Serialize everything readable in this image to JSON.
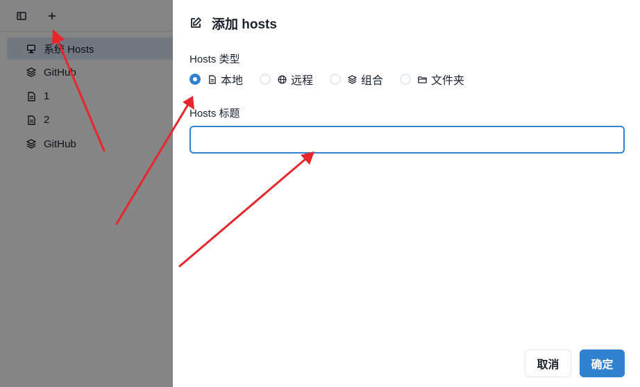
{
  "sidebar": {
    "items": [
      {
        "label": "系统 Hosts",
        "icon": "monitor-icon",
        "selected": true
      },
      {
        "label": "GitHub",
        "icon": "layers-icon",
        "selected": false
      },
      {
        "label": "1",
        "icon": "file-icon",
        "selected": false
      },
      {
        "label": "2",
        "icon": "file-icon",
        "selected": false
      },
      {
        "label": "GitHub",
        "icon": "layers-icon",
        "selected": false
      }
    ]
  },
  "drawer": {
    "title": "添加 hosts",
    "type_label": "Hosts 类型",
    "type_options": [
      {
        "label": "本地",
        "icon": "file-icon",
        "checked": true
      },
      {
        "label": "远程",
        "icon": "globe-icon",
        "checked": false
      },
      {
        "label": "组合",
        "icon": "layers-icon",
        "checked": false
      },
      {
        "label": "文件夹",
        "icon": "folder-icon",
        "checked": false
      }
    ],
    "title_label": "Hosts 标题",
    "title_value": "",
    "cancel_label": "取消",
    "ok_label": "确定"
  },
  "colors": {
    "accent": "#3182ce",
    "annotation": "#e8262b",
    "selected_bg": "#dbe7f6"
  }
}
